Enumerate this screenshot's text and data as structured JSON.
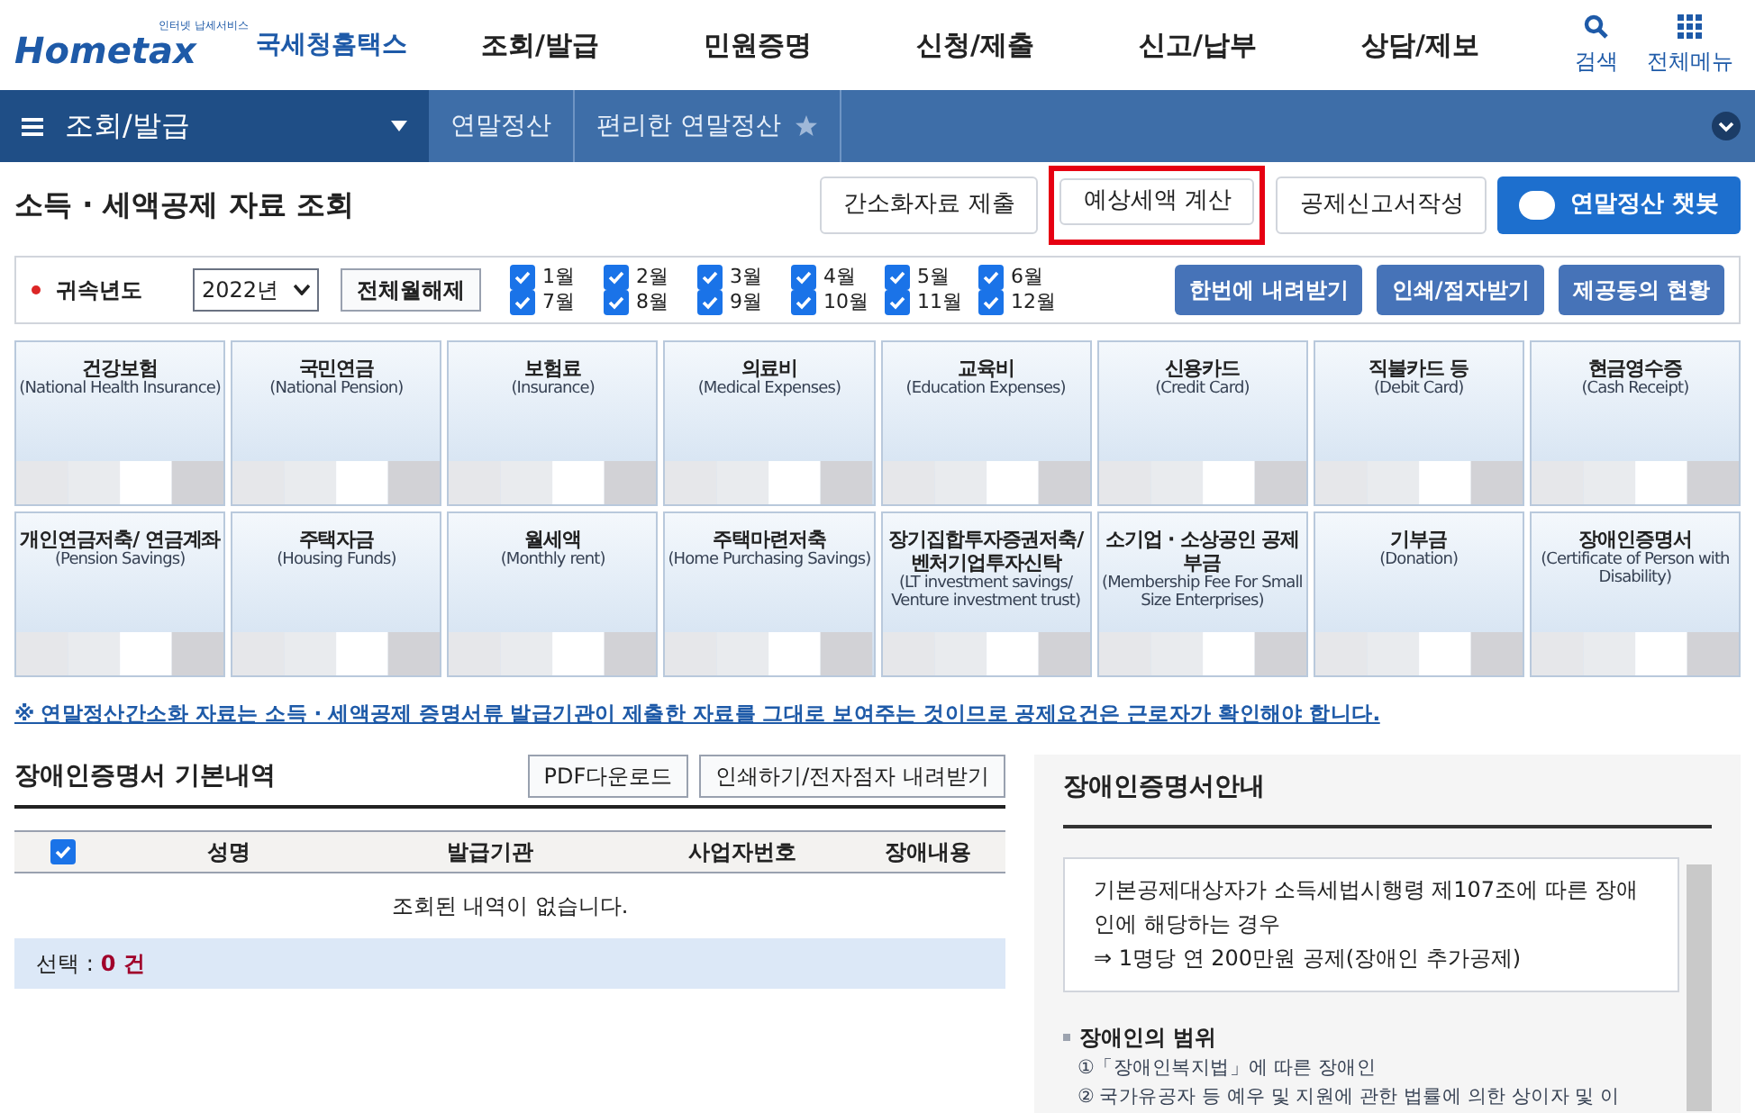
{
  "header": {
    "logo": {
      "tagline": "인터넷 납세서비스",
      "brand": "Hometax",
      "name": "국세청홈택스"
    },
    "menu": [
      "조회/발급",
      "민원증명",
      "신청/제출",
      "신고/납부",
      "상담/제보"
    ],
    "tools": [
      {
        "kind": "search",
        "label": "검색"
      },
      {
        "kind": "grid",
        "label": "전체메뉴"
      }
    ]
  },
  "breadcrumb": {
    "section": "조회/발급",
    "items": [
      "연말정산",
      "편리한 연말정산"
    ],
    "favorite": false
  },
  "page_title": "소득 · 세액공제 자료 조회",
  "title_buttons": [
    {
      "label": "간소화자료 제출",
      "kind": "plain",
      "highlighted": false
    },
    {
      "label": "예상세액 계산",
      "kind": "plain",
      "highlighted": true
    },
    {
      "label": "공제신고서작성",
      "kind": "plain",
      "highlighted": false
    },
    {
      "label": "연말정산 챗봇",
      "kind": "bot"
    }
  ],
  "filter": {
    "label": "귀속년도",
    "year": "2022년",
    "clear_button": "전체월해제",
    "months": [
      {
        "label": "1월",
        "checked": true
      },
      {
        "label": "2월",
        "checked": true
      },
      {
        "label": "3월",
        "checked": true
      },
      {
        "label": "4월",
        "checked": true
      },
      {
        "label": "5월",
        "checked": true
      },
      {
        "label": "6월",
        "checked": true
      },
      {
        "label": "7월",
        "checked": true
      },
      {
        "label": "8월",
        "checked": true
      },
      {
        "label": "9월",
        "checked": true
      },
      {
        "label": "10월",
        "checked": true
      },
      {
        "label": "11월",
        "checked": true
      },
      {
        "label": "12월",
        "checked": true
      }
    ],
    "buttons": [
      "한번에 내려받기",
      "인쇄/점자받기",
      "제공동의 현황"
    ]
  },
  "categories": [
    {
      "title": "건강보험",
      "subtitle": "(National Health Insurance)"
    },
    {
      "title": "국민연금",
      "subtitle": "(National Pension)"
    },
    {
      "title": "보험료",
      "subtitle": "(Insurance)"
    },
    {
      "title": "의료비",
      "subtitle": "(Medical Expenses)"
    },
    {
      "title": "교육비",
      "subtitle": "(Education Expenses)"
    },
    {
      "title": "신용카드",
      "subtitle": "(Credit Card)"
    },
    {
      "title": "직불카드 등",
      "subtitle": "(Debit Card)"
    },
    {
      "title": "현금영수증",
      "subtitle": "(Cash Receipt)"
    },
    {
      "title": "개인연금저축/ 연금계좌",
      "subtitle": "(Pension Savings)"
    },
    {
      "title": "주택자금",
      "subtitle": "(Housing Funds)"
    },
    {
      "title": "월세액",
      "subtitle": "(Monthly rent)"
    },
    {
      "title": "주택마련저축",
      "subtitle": "(Home Purchasing Savings)"
    },
    {
      "title": "장기집합투자증권저축/ 벤처기업투자신탁",
      "subtitle": "(LT investment savings/ Venture investment trust)"
    },
    {
      "title": "소기업 · 소상공인 공제부금",
      "subtitle": "(Membership Fee For Small Size Enterprises)"
    },
    {
      "title": "기부금",
      "subtitle": "(Donation)"
    },
    {
      "title": "장애인증명서",
      "subtitle": "(Certificate of Person with Disability)"
    }
  ],
  "notice": "※ 연말정산간소화 자료는 소득 · 세액공제 증명서류 발급기관이 제출한 자료를 그대로 보여주는 것이므로 공제요건은 근로자가 확인해야 합니다.",
  "detail": {
    "title": "장애인증명서 기본내역",
    "buttons": [
      "PDF다운로드",
      "인쇄하기/전자점자 내려받기"
    ],
    "select_all": true,
    "columns": [
      "성명",
      "발급기관",
      "사업자번호",
      "장애내용"
    ],
    "empty": "조회된 내역이 없습니다.",
    "selected_label": "선택 :",
    "selected_count": "0 건"
  },
  "guide": {
    "title": "장애인증명서안내",
    "box": [
      "기본공제대상자가 소득세법시행령 제107조에 따른 장애인에 해당하는 경우",
      "⇒ 1명당 연 200만원 공제(장애인 추가공제)"
    ],
    "section": "장애인의 범위",
    "items": [
      "①「장애인복지법」에 따른 장애인",
      "② 국가유공자 등 예우 및 지원에 관한 법률에 의한 상이자 및 이"
    ]
  }
}
